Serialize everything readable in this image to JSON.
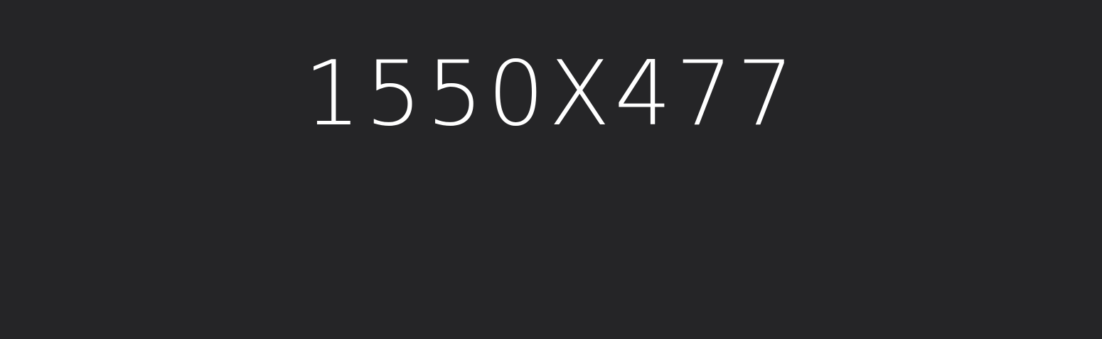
{
  "placeholder": {
    "dimension_text": "1550X477",
    "background_color": "#252527",
    "text_color": "#ffffff"
  }
}
